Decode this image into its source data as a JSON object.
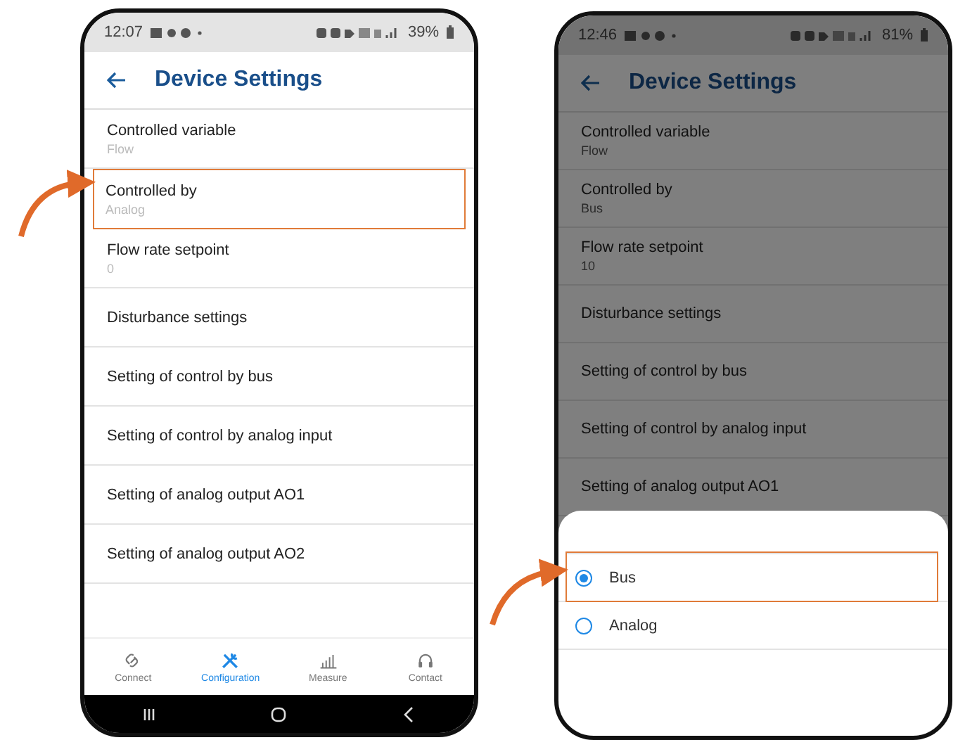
{
  "phones": [
    {
      "status_bar": {
        "time": "12:07",
        "battery": "39%"
      },
      "title": "Device Settings",
      "dimmed": false,
      "items": [
        {
          "label": "Controlled variable",
          "value": "Flow",
          "highlighted": false
        },
        {
          "label": "Controlled by",
          "value": "Analog",
          "highlighted": true
        },
        {
          "label": "Flow rate setpoint",
          "value": "0",
          "highlighted": false
        },
        {
          "label": "Disturbance settings",
          "highlighted": false
        },
        {
          "label": "Setting of control by bus",
          "highlighted": false
        },
        {
          "label": "Setting of control by analog input",
          "highlighted": false
        },
        {
          "label": "Setting of analog output AO1",
          "highlighted": false
        },
        {
          "label": "Setting of analog output AO2",
          "highlighted": false
        }
      ],
      "bottom_nav": [
        {
          "label": "Connect",
          "selected": false
        },
        {
          "label": "Configuration",
          "selected": true
        },
        {
          "label": "Measure",
          "selected": false
        },
        {
          "label": "Contact",
          "selected": false
        }
      ]
    },
    {
      "status_bar": {
        "time": "12:46",
        "battery": "81%"
      },
      "title": "Device Settings",
      "dimmed": true,
      "items": [
        {
          "label": "Controlled variable",
          "value": "Flow",
          "highlighted": false
        },
        {
          "label": "Controlled by",
          "value": "Bus",
          "highlighted": false
        },
        {
          "label": "Flow rate setpoint",
          "value": "10",
          "highlighted": false
        },
        {
          "label": "Disturbance settings",
          "highlighted": false
        },
        {
          "label": "Setting of control by bus",
          "highlighted": false
        },
        {
          "label": "Setting of control by analog input",
          "highlighted": false
        },
        {
          "label": "Setting of analog output AO1",
          "highlighted": false
        }
      ],
      "sheet": {
        "options": [
          {
            "label": "Bus",
            "selected": true,
            "highlighted": true
          },
          {
            "label": "Analog",
            "selected": false,
            "highlighted": false
          }
        ]
      }
    }
  ]
}
